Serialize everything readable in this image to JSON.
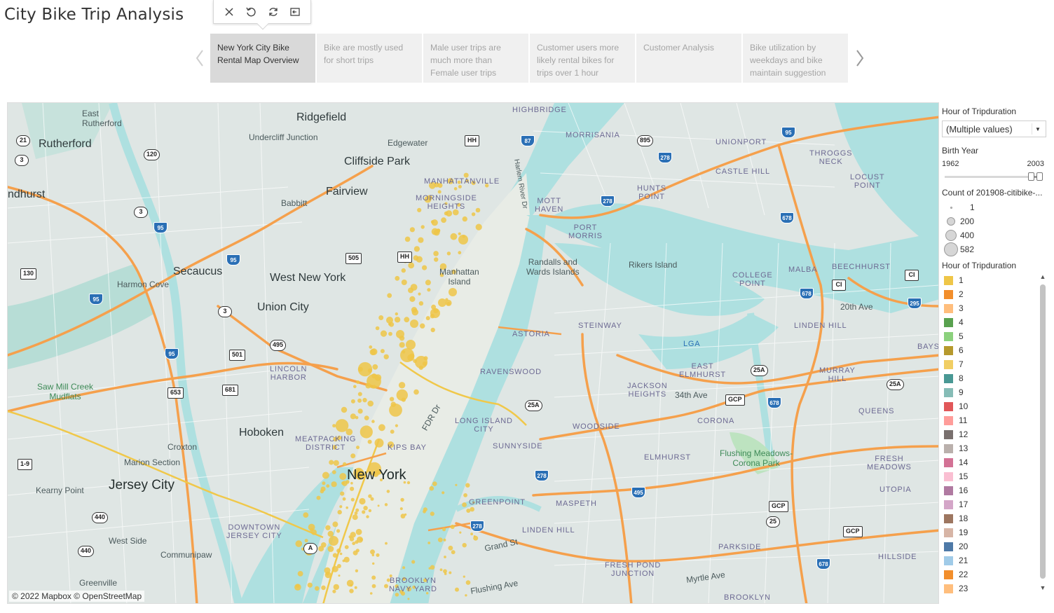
{
  "title": "City Bike Trip Analysis",
  "toolbar": {
    "buttons": [
      "close-icon",
      "revert-icon",
      "refresh-icon",
      "exit-icon"
    ]
  },
  "story_points": [
    {
      "label": "New York City Bike Rental Map Overview",
      "active": true
    },
    {
      "label": "Bike are mostly used for short trips",
      "active": false
    },
    {
      "label": "Male user trips are much more than Female user trips",
      "active": false
    },
    {
      "label": "Customer users more likely rental bikes for trips over 1 hour",
      "active": false
    },
    {
      "label": "Customer Analysis",
      "active": false
    },
    {
      "label": "Bike utilization by weekdays and bike maintain suggestion",
      "active": false
    }
  ],
  "map": {
    "attribution": "© 2022 Mapbox © OpenStreetMap",
    "colors": {
      "water": "#aee0e0",
      "land": "#dfe6e4",
      "major_road": "#f5a04c",
      "highway": "#f0c84a",
      "point": "#efc648"
    },
    "labels": {
      "east_rutherford": "East\nRutherford",
      "rutherford": "Rutherford",
      "lyndhurst": "ndhurst",
      "ridgefield": "Ridgefield",
      "undercliff": "Undercliff Junction",
      "edgewater": "Edgewater",
      "cliffside": "Cliffside Park",
      "fairview": "Fairview",
      "babbitt": "Babbitt",
      "secaucus": "Secaucus",
      "harmon": "Harmon Cove",
      "west_new_york": "West New York",
      "union_city": "Union City",
      "lincoln_harbor": "LINCOLN\nHARBOR",
      "hoboken": "Hoboken",
      "croxton": "Croxton",
      "marion": "Marion Section",
      "jersey_city": "Jersey City",
      "kearny": "Kearny Point",
      "downtown_jc": "DOWNTOWN\nJERSEY CITY",
      "west_side": "West Side",
      "communipaw": "Communipaw",
      "greenville": "Greenville",
      "sawmill": "Saw Mill Creek\nMudflats",
      "manhattanville": "MANHATTANVILLE",
      "morningside": "MORNINGSIDE\nHEIGHTS",
      "manhattan_island": "Manhattan\nIsland",
      "new_york": "New York",
      "kips_bay": "KIPS BAY",
      "meatpacking": "MEATPACKING\nDISTRICT",
      "highbridge": "HIGHBRIDGE",
      "morrisania": "MORRISANIA",
      "mott_haven": "MOTT\nHAVEN",
      "port_morris": "PORT\nMORRIS",
      "hunts_point": "HUNTS\nPOINT",
      "randalls": "Randalls and\nWards Islands",
      "rikers": "Rikers Island",
      "astoria": "ASTORIA",
      "steinway": "STEINWAY",
      "ravenswood": "RAVENSWOOD",
      "lic": "LONG ISLAND\nCITY",
      "sunnyside": "SUNNYSIDE",
      "woodside": "WOODSIDE",
      "jackson_heights": "JACKSON\nHEIGHTS",
      "east_elmhurst": "EAST\nELMHURST",
      "lga": "LGA",
      "corona": "CORONA",
      "elmhurst": "ELMHURST",
      "maspeth": "MASPETH",
      "greenpoint": "GREENPOINT",
      "linden_hill_q": "LINDEN HILL",
      "fresh_pond": "FRESH POND\nJUNCTION",
      "flushing": "Flushing Meadows-\nCorona Park",
      "queens": "QUEENS",
      "fresh_meadows": "FRESH\nMEADOWS",
      "utopia": "UTOPIA",
      "parkside": "PARKSIDE",
      "hillside": "HILLSIDE",
      "brooklyn": "BROOKLYN",
      "brooklyn_navy": "BROOKLYN\nNAVY YARD",
      "unionport": "UNIONPORT",
      "castle_hill": "CASTLE HILL",
      "throggs": "THROGGS\nNECK",
      "locust": "LOCUST\nPOINT",
      "college_point": "COLLEGE\nPOINT",
      "malba": "MALBA",
      "beechhurst": "BEECHHURST",
      "linden_hill_n": "LINDEN HILL",
      "murray_hill": "MURRAY\nHILL",
      "bays": "BAYS",
      "twentieth": "20th Ave",
      "thirtyfourth": "34th Ave",
      "myrtle": "Myrtle Ave",
      "flushing_ave": "Flushing Ave",
      "grand": "Grand St",
      "fdr": "FDR Dr",
      "harlem_river": "Harlem River Dr"
    }
  },
  "filters": {
    "hour_filter_title": "Hour of Tripduration",
    "hour_filter_value": "(Multiple values)",
    "birth_year_title": "Birth Year",
    "birth_year_min": "1962",
    "birth_year_max": "2003",
    "birth_year_range_fraction": [
      0.91,
      1.0
    ]
  },
  "size_legend": {
    "title": "Count of 201908-citibike-...",
    "items": [
      "1",
      "200",
      "400",
      "582"
    ]
  },
  "color_legend": {
    "title": "Hour of Tripduration",
    "items": [
      {
        "label": "1",
        "color": "#efc648"
      },
      {
        "label": "2",
        "color": "#f28e2b"
      },
      {
        "label": "3",
        "color": "#ffbe7d"
      },
      {
        "label": "4",
        "color": "#59a14f"
      },
      {
        "label": "5",
        "color": "#8cd17d"
      },
      {
        "label": "6",
        "color": "#b6992d"
      },
      {
        "label": "7",
        "color": "#f1ce63"
      },
      {
        "label": "8",
        "color": "#499894"
      },
      {
        "label": "9",
        "color": "#86bcb6"
      },
      {
        "label": "10",
        "color": "#e15759"
      },
      {
        "label": "11",
        "color": "#ff9d9a"
      },
      {
        "label": "12",
        "color": "#79706e"
      },
      {
        "label": "13",
        "color": "#bab0ac"
      },
      {
        "label": "14",
        "color": "#d37295"
      },
      {
        "label": "15",
        "color": "#fabfd2"
      },
      {
        "label": "16",
        "color": "#b07aa1"
      },
      {
        "label": "17",
        "color": "#d4a6c8"
      },
      {
        "label": "18",
        "color": "#9d7660"
      },
      {
        "label": "19",
        "color": "#d7b5a6"
      },
      {
        "label": "20",
        "color": "#4e79a7"
      },
      {
        "label": "21",
        "color": "#a0cbe8"
      },
      {
        "label": "22",
        "color": "#f28e2b"
      },
      {
        "label": "23",
        "color": "#ffbe7d"
      }
    ]
  }
}
